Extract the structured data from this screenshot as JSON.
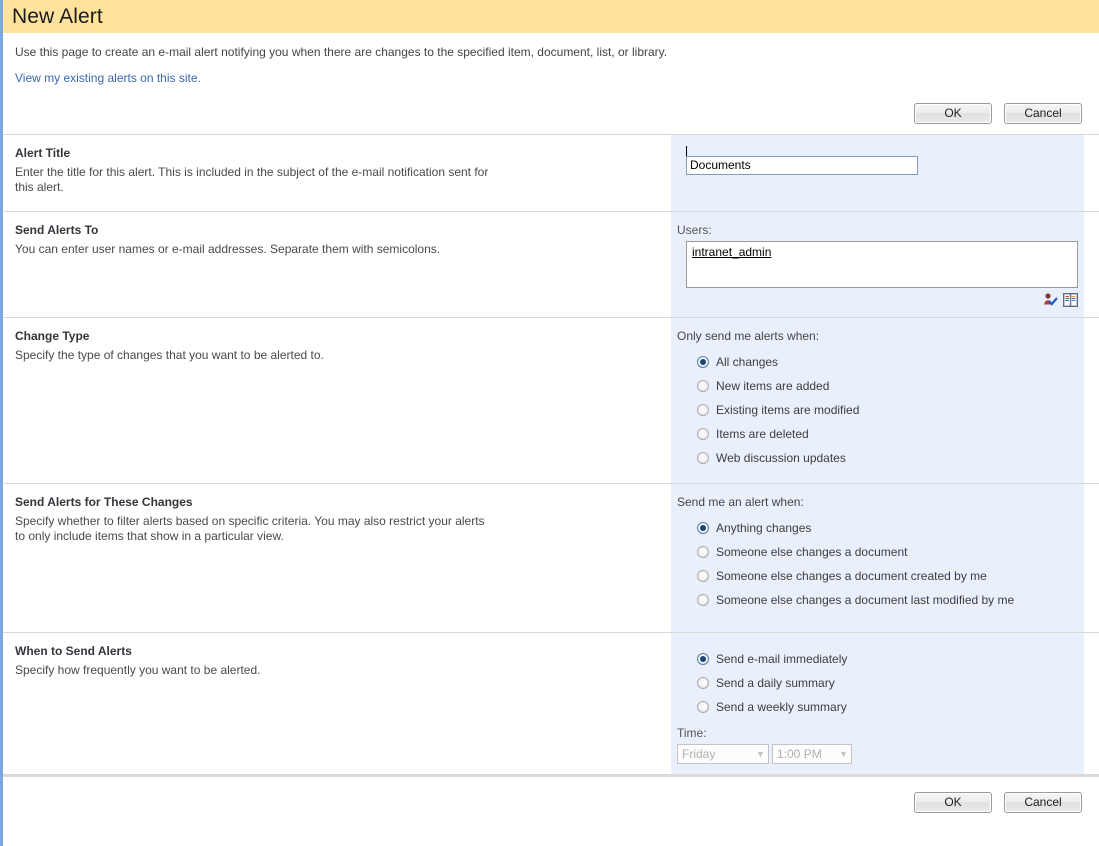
{
  "header": {
    "title": "New Alert",
    "banner_color": "#ffe39c"
  },
  "intro": {
    "lead": "Use this page to create an e-mail alert notifying you when there are changes to the specified item, document, list, or library.",
    "alerts_link": "View my existing alerts on this site.",
    "link_color": "#3b66b0"
  },
  "buttons": {
    "ok_label": "OK",
    "cancel_label": "Cancel"
  },
  "sections": {
    "alert_title": {
      "title": "Alert Title",
      "description": "Enter the title for this alert. This is included in the subject of the e-mail notification sent for this alert.",
      "input_value": "Documents",
      "input_placeholder": ""
    },
    "send_alerts_to": {
      "title": "Send Alerts To",
      "description": "You can enter user names or e-mail addresses. Separate them with semicolons.",
      "users_label": "Users:",
      "users_value": "intranet_admin",
      "check_names_icon": "check-names-icon",
      "address_book_icon": "address-book-icon"
    },
    "change_type": {
      "title": "Change Type",
      "description": "Specify the type of changes that you want to be alerted to.",
      "group_label": "Only send me alerts when:",
      "options": [
        {
          "label": "All changes",
          "selected": true
        },
        {
          "label": "New items are added",
          "selected": false
        },
        {
          "label": "Existing items are modified",
          "selected": false
        },
        {
          "label": "Items are deleted",
          "selected": false
        },
        {
          "label": "Web discussion updates",
          "selected": false
        }
      ]
    },
    "send_alerts_for_changes": {
      "title": "Send Alerts for These Changes",
      "description": "Specify whether to filter alerts based on specific criteria. You may also restrict your alerts to only include items that show in a particular view.",
      "group_label": "Send me an alert when:",
      "options": [
        {
          "label": "Anything changes",
          "selected": true
        },
        {
          "label": "Someone else changes a document",
          "selected": false
        },
        {
          "label": "Someone else changes a document created by me",
          "selected": false
        },
        {
          "label": "Someone else changes a document last modified by me",
          "selected": false
        }
      ]
    },
    "when_to_send": {
      "title": "When to Send Alerts",
      "description": "Specify how frequently you want to be alerted.",
      "options": [
        {
          "label": "Send e-mail immediately",
          "selected": true
        },
        {
          "label": "Send a daily summary",
          "selected": false
        },
        {
          "label": "Send a weekly summary",
          "selected": false
        }
      ],
      "time_label": "Time:",
      "day_value": "Friday",
      "hour_value": "1:00 PM",
      "disabled": true
    }
  }
}
